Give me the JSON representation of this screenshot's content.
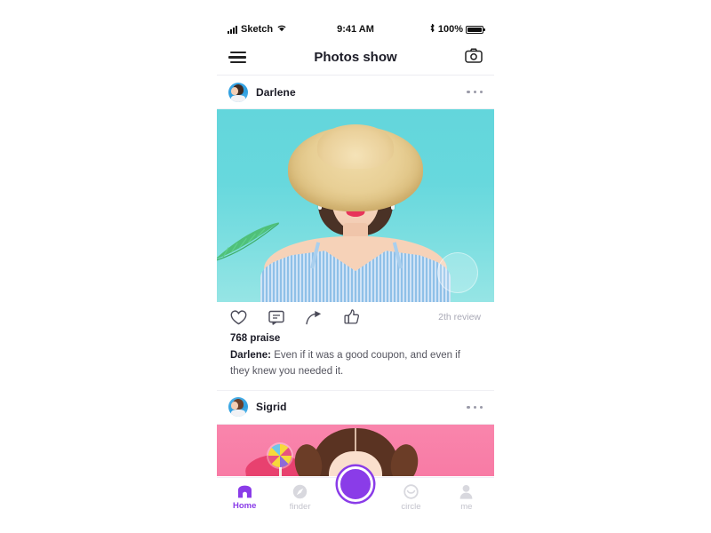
{
  "statusbar": {
    "carrier": "Sketch",
    "time": "9:41 AM",
    "battery_percent": "100%",
    "signal_icon": "signal-bars-icon",
    "wifi_icon": "wifi-icon",
    "bluetooth_icon": "bluetooth-icon",
    "battery_icon": "battery-full-icon"
  },
  "navbar": {
    "title": "Photos show",
    "menu_icon": "hamburger-menu-icon",
    "camera_icon": "camera-icon"
  },
  "feed": {
    "posts": [
      {
        "author": "Darlene",
        "avatar_icon": "user-avatar",
        "more_icon": "more-options-icon",
        "photo_alt": "woman-in-straw-hat-turquoise-background",
        "actions": [
          {
            "name": "like",
            "icon": "heart-icon"
          },
          {
            "name": "comment",
            "icon": "comment-bubble-icon"
          },
          {
            "name": "share",
            "icon": "share-arrow-icon"
          },
          {
            "name": "praise",
            "icon": "thumbs-up-icon"
          }
        ],
        "review_count": "2th review",
        "praise_count": "768 praise",
        "comment_author": "Darlene:",
        "comment_text": "Even if it was a good coupon, and even if they knew you needed it."
      },
      {
        "author": "Sigrid",
        "avatar_icon": "user-avatar",
        "more_icon": "more-options-icon",
        "photo_alt": "girl-with-pigtails-and-lollipop-pink-background"
      }
    ]
  },
  "tabbar": {
    "items": [
      {
        "label": "Home",
        "icon": "home-icon",
        "active": true
      },
      {
        "label": "finder",
        "icon": "compass-icon",
        "active": false
      },
      {
        "label": "circle",
        "icon": "circle-icon",
        "active": false
      },
      {
        "label": "me",
        "icon": "person-icon",
        "active": false
      }
    ],
    "center_button_icon": "camera-shutter-button"
  },
  "colors": {
    "accent": "#8a3ce8",
    "text_primary": "#1b1b26",
    "text_secondary": "#55555f",
    "text_muted": "#a9a9b6",
    "photo1_bg": "#67d8dd",
    "photo2_bg": "#f87ba5"
  }
}
